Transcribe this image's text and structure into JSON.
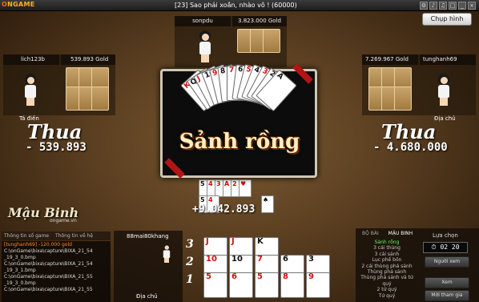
{
  "app": {
    "logo_main": "O",
    "logo_text": "NGAME"
  },
  "window": {
    "title": "[23] Sao phải xoắn, nhào vô ! (60000)"
  },
  "capture_label": "Chụp hình",
  "players": {
    "top": {
      "name": "sonpdu",
      "gold": "3.823.000 Gold"
    },
    "left": {
      "name": "lich123b",
      "gold": "539.893 Gold",
      "label": "Tá điền",
      "result": "Thua",
      "amount": "- 539.893"
    },
    "right": {
      "name": "tunghanh69",
      "gold": "7.269.967 Gold",
      "label": "Địa chủ",
      "result": "Thua",
      "amount": "- 4.680.000"
    },
    "bottom": {
      "name": "88mai80khang",
      "label": "Địa chủ",
      "gain": "+9.042.893"
    }
  },
  "banner": {
    "text": "Sảnh rồng",
    "fan_ranks": [
      "K",
      "Q",
      "J",
      "10",
      "9",
      "8",
      "7",
      "6",
      "5",
      "4",
      "3",
      "2",
      "A"
    ]
  },
  "brand": {
    "name": "Mậu Binh",
    "site": "ongame.vn"
  },
  "log": {
    "tabs": [
      "Thông tin số game",
      "Thông tin về hệ thống"
    ],
    "lines": [
      "[tunghanh69] -120.000 gold",
      "C:\\onGame\\bixa\\capture\\BIXA_21_54",
      "_19_3_0.bmp",
      "C:\\onGame\\bixa\\capture\\BIXA_21_54",
      "_19_3_1.bmp",
      "C:\\onGame\\bixa\\capture\\BIXA_21_55",
      "_19_3_0.bmp",
      "C:\\onGame\\bixa\\capture\\BIXA_21_55"
    ]
  },
  "rows": [
    "3",
    "2",
    "1"
  ],
  "hand": {
    "row3": [
      {
        "r": "J",
        "red": true
      },
      {
        "r": "J",
        "red": true
      },
      {
        "r": "K",
        "red": false
      }
    ],
    "row2": [
      {
        "r": "10",
        "red": true
      },
      {
        "r": "10",
        "red": false
      },
      {
        "r": "7",
        "red": true
      },
      {
        "r": "6",
        "red": false
      },
      {
        "r": "3",
        "red": false
      }
    ],
    "row1": [
      {
        "r": "5",
        "red": true
      },
      {
        "r": "6",
        "red": true
      },
      {
        "r": "5",
        "red": true
      },
      {
        "r": "8",
        "red": true
      },
      {
        "r": "9",
        "red": true
      }
    ]
  },
  "right_panel": {
    "tabs": [
      "BỘ BÀI",
      "MẬU BINH"
    ],
    "combos": [
      "Sảnh rồng",
      "3 cái thùng",
      "3 cái sảnh",
      "Lục phế bôn",
      "2 cái thùng phá sảnh",
      "Thùng phá sảnh",
      "Thùng phá sảnh và tứ quý",
      "2 tứ quý",
      "Tứ quý"
    ],
    "active_index": 0,
    "choose_label": "Lựa chọn",
    "timer": "02 20",
    "btn_invite": "Người xem",
    "btn_view": "Xem",
    "btn_join": "Mời tham gia"
  }
}
